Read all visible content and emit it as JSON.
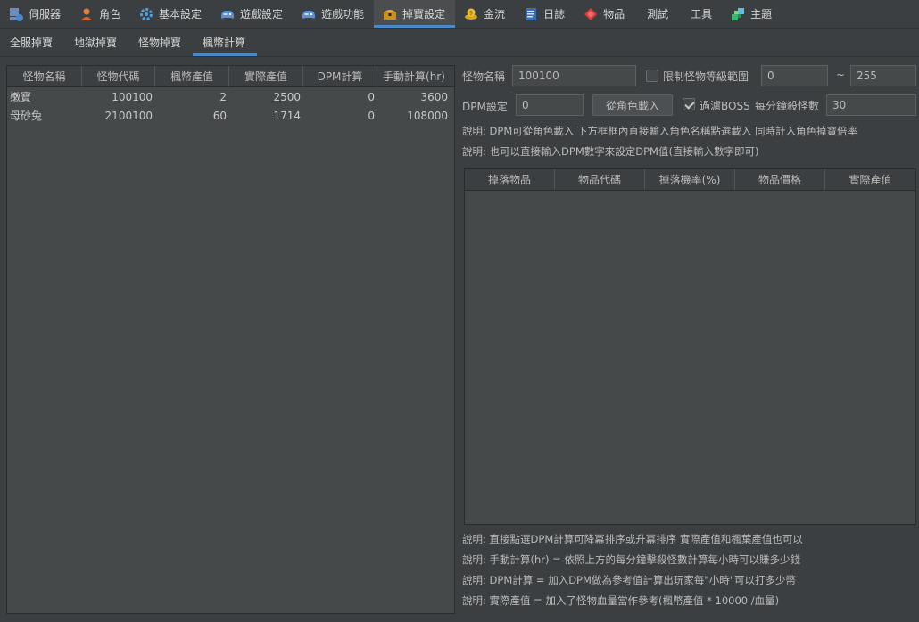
{
  "menu": {
    "tabs": [
      {
        "label": "伺服器",
        "icon": "server-icon"
      },
      {
        "label": "角色",
        "icon": "person-icon"
      },
      {
        "label": "基本設定",
        "icon": "gear-icon"
      },
      {
        "label": "遊戲設定",
        "icon": "gamepad-icon"
      },
      {
        "label": "遊戲功能",
        "icon": "gamepad-icon"
      },
      {
        "label": "掉寶設定",
        "icon": "treasure-icon"
      },
      {
        "label": "金流",
        "icon": "coin-icon"
      },
      {
        "label": "日誌",
        "icon": "log-icon"
      },
      {
        "label": "物品",
        "icon": "item-icon"
      },
      {
        "label": "測試",
        "icon": ""
      },
      {
        "label": "工具",
        "icon": ""
      },
      {
        "label": "主題",
        "icon": "palette-icon"
      }
    ],
    "active_index": 5
  },
  "subtabs": {
    "items": [
      "全服掉寶",
      "地獄掉寶",
      "怪物掉寶",
      "楓幣計算"
    ],
    "active_index": 3
  },
  "monster_table": {
    "columns": [
      "怪物名稱",
      "怪物代碼",
      "楓幣產值",
      "實際產值",
      "DPM計算",
      "手動計算(hr)"
    ],
    "rows": [
      [
        "嫩寶",
        "100100",
        "2",
        "2500",
        "0",
        "3600"
      ],
      [
        "母砂兔",
        "2100100",
        "60",
        "1714",
        "0",
        "108000"
      ]
    ]
  },
  "form": {
    "monster_name_label": "怪物名稱",
    "monster_name_value": "100100",
    "limit_level_label": "限制怪物等級範圍",
    "limit_level_checked": false,
    "level_min": "0",
    "level_sep": "~",
    "level_max": "255",
    "dpm_label": "DPM設定",
    "dpm_value": "0",
    "load_button": "從角色載入",
    "filter_boss_label": "過濾BOSS",
    "filter_boss_checked": true,
    "kills_per_min_label": "每分鐘殺怪數",
    "kills_per_min_value": "30"
  },
  "notes_top": [
    "說明: DPM可從角色載入 下方框框內直接輸入角色名稱點選載入 同時計入角色掉寶倍率",
    "說明: 也可以直接輸入DPM數字來設定DPM值(直接輸入數字即可)"
  ],
  "drop_table": {
    "columns": [
      "掉落物品",
      "物品代碼",
      "掉落機率(%)",
      "物品價格",
      "實際產值"
    ],
    "rows": []
  },
  "notes_bottom": [
    "說明: 直接點選DPM計算可降冪排序或升冪排序 實際產值和楓葉產值也可以",
    "說明: 手動計算(hr) = 依照上方的每分鐘擊殺怪數計算每小時可以賺多少錢",
    "說明: DPM計算 = 加入DPM做為參考值計算出玩家每\"小時\"可以打多少幣",
    "說明: 實際產值 = 加入了怪物血量當作參考(楓幣產值 * 10000 /血量)"
  ],
  "colors": {
    "accent": "#4a88c7",
    "background": "#3c3f41",
    "panel": "#45494a"
  }
}
